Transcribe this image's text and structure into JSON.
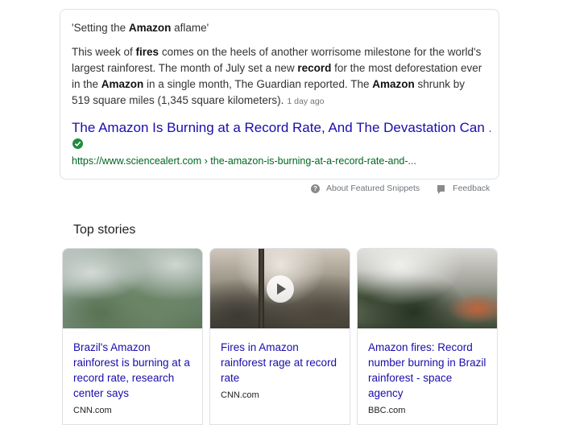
{
  "featured_snippet": {
    "heading_prefix": "'Setting the ",
    "heading_bold": "Amazon",
    "heading_suffix": " aflame'",
    "body": [
      {
        "t": "This week of "
      },
      {
        "b": "fires"
      },
      {
        "t": " comes on the heels of another worrisome milestone for the world's largest rainforest. The month of July set a new "
      },
      {
        "b": "record"
      },
      {
        "t": " for the most deforestation ever in the "
      },
      {
        "b": "Amazon"
      },
      {
        "t": " in a single month, The Guardian reported. The "
      },
      {
        "b": "Amazon"
      },
      {
        "t": " shrunk by 519 square miles (1,345 square kilometers)."
      }
    ],
    "date": "1 day ago",
    "result_title": "The Amazon Is Burning at a Record Rate, And The Devastation Can ...",
    "verified_icon": "check-circle-icon",
    "result_url": "https://www.sciencealert.com › the-amazon-is-burning-at-a-record-rate-and-..."
  },
  "footer": {
    "about_label": "About Featured Snippets",
    "feedback_label": "Feedback"
  },
  "top_stories": {
    "heading": "Top stories",
    "items": [
      {
        "title": "Brazil's Amazon rainforest is burning at a record rate, research center says",
        "source": "CNN.com",
        "video": false
      },
      {
        "title": "Fires in Amazon rainforest rage at record rate",
        "source": "CNN.com",
        "video": true
      },
      {
        "title": "Amazon fires: Record number burning in Brazil rainforest - space agency",
        "source": "BBC.com",
        "video": false
      }
    ]
  },
  "colors": {
    "link": "#1a0dab",
    "url_green": "#006621",
    "verified_green": "#1e8e3e",
    "border": "#dfe1e5",
    "muted": "#70757a"
  }
}
